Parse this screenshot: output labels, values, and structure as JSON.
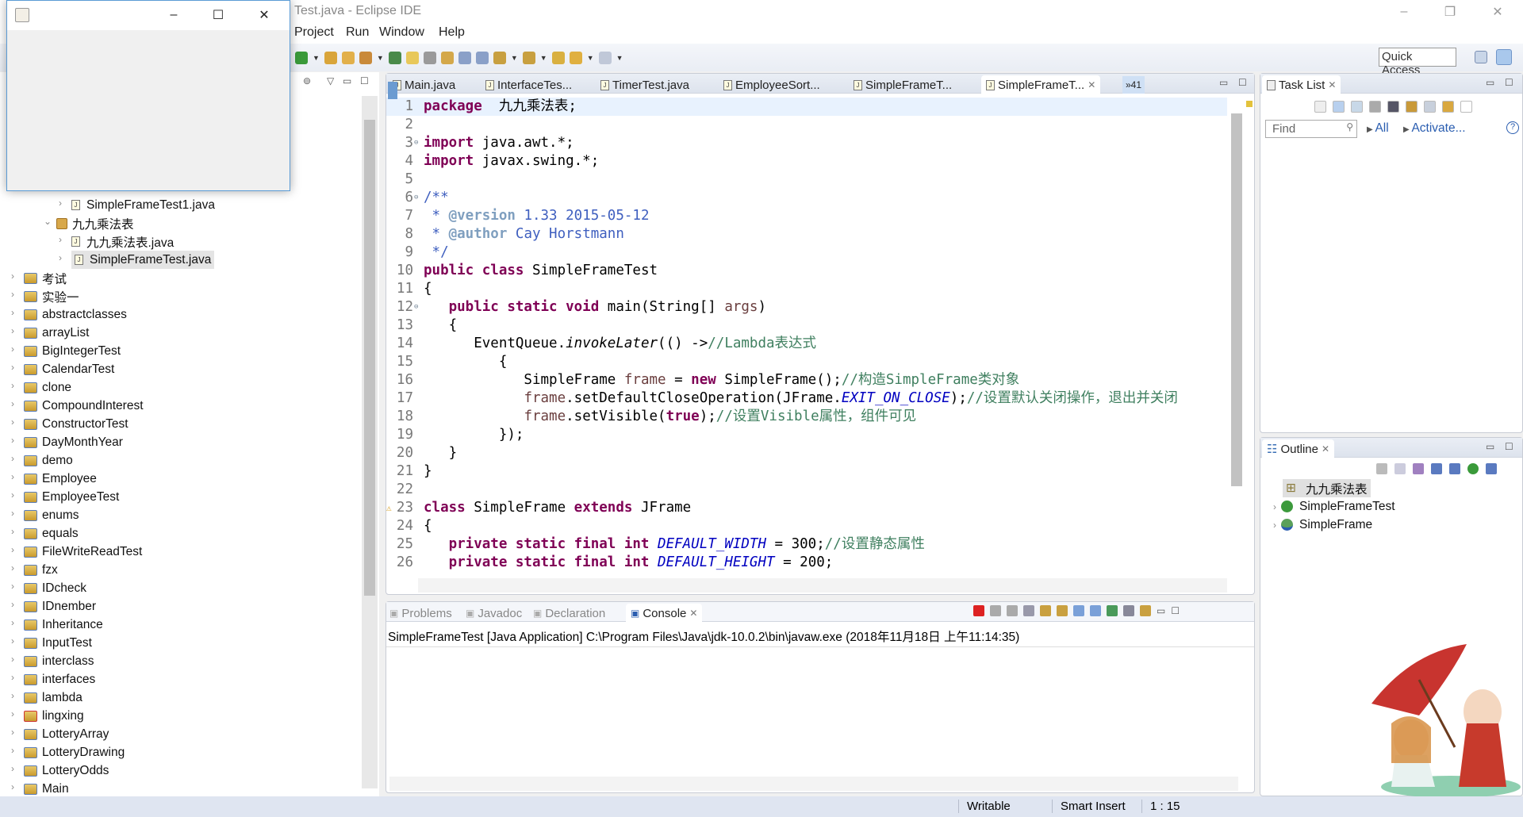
{
  "window": {
    "title": "Test.java - Eclipse IDE",
    "min": "–",
    "restore": "❐",
    "close": "✕"
  },
  "menu": [
    "Project",
    "Run",
    "Window",
    "Help"
  ],
  "toolbar": {
    "icons": [
      "run-icon",
      "dropdown",
      "open-project-icon",
      "open-file-icon",
      "wand-icon",
      "dropdown",
      "help-icon",
      "highlight-icon",
      "tool-icon",
      "annotation-icon",
      "block-icon",
      "pilcrow-icon",
      "next-annotation-icon",
      "dropdown",
      "prev-annotation-icon",
      "dropdown",
      "last-edit-icon",
      "back-icon",
      "dropdown",
      "forward-icon",
      "dropdown"
    ],
    "quick_access": "Quick Access"
  },
  "java_window": {
    "min": "–",
    "max": "☐",
    "close": "✕"
  },
  "explorer": {
    "rows": [
      {
        "label": "SimpleFrameTest1.java",
        "depth": 2,
        "type": "file",
        "expanded": false
      },
      {
        "label": "九九乘法表",
        "depth": 1,
        "type": "package",
        "expanded": true
      },
      {
        "label": "九九乘法表.java",
        "depth": 2,
        "type": "file",
        "expanded": false
      },
      {
        "label": "SimpleFrameTest.java",
        "depth": 2,
        "type": "file",
        "expanded": false,
        "selected": true
      },
      {
        "label": "考试",
        "depth": 0,
        "type": "project"
      },
      {
        "label": "实验一",
        "depth": 0,
        "type": "project"
      },
      {
        "label": "abstractclasses",
        "depth": 0,
        "type": "project"
      },
      {
        "label": "arrayList",
        "depth": 0,
        "type": "project"
      },
      {
        "label": "BigIntegerTest",
        "depth": 0,
        "type": "project"
      },
      {
        "label": "CalendarTest",
        "depth": 0,
        "type": "project"
      },
      {
        "label": "clone",
        "depth": 0,
        "type": "project"
      },
      {
        "label": "CompoundInterest",
        "depth": 0,
        "type": "project"
      },
      {
        "label": "ConstructorTest",
        "depth": 0,
        "type": "project"
      },
      {
        "label": "DayMonthYear",
        "depth": 0,
        "type": "project"
      },
      {
        "label": "demo",
        "depth": 0,
        "type": "project"
      },
      {
        "label": "Employee",
        "depth": 0,
        "type": "project"
      },
      {
        "label": "EmployeeTest",
        "depth": 0,
        "type": "project"
      },
      {
        "label": "enums",
        "depth": 0,
        "type": "project"
      },
      {
        "label": "equals",
        "depth": 0,
        "type": "project"
      },
      {
        "label": "FileWriteReadTest",
        "depth": 0,
        "type": "project"
      },
      {
        "label": "fzx",
        "depth": 0,
        "type": "project"
      },
      {
        "label": "IDcheck",
        "depth": 0,
        "type": "project"
      },
      {
        "label": "IDnember",
        "depth": 0,
        "type": "project"
      },
      {
        "label": "Inheritance",
        "depth": 0,
        "type": "project"
      },
      {
        "label": "InputTest",
        "depth": 0,
        "type": "project"
      },
      {
        "label": "interclass",
        "depth": 0,
        "type": "project"
      },
      {
        "label": "interfaces",
        "depth": 0,
        "type": "project"
      },
      {
        "label": "lambda",
        "depth": 0,
        "type": "project"
      },
      {
        "label": "lingxing",
        "depth": 0,
        "type": "project"
      },
      {
        "label": "LotteryArray",
        "depth": 0,
        "type": "project"
      },
      {
        "label": "LotteryDrawing",
        "depth": 0,
        "type": "project"
      },
      {
        "label": "LotteryOdds",
        "depth": 0,
        "type": "project"
      },
      {
        "label": "Main",
        "depth": 0,
        "type": "project"
      }
    ]
  },
  "editor": {
    "tabs": [
      "Main.java",
      "InterfaceTes...",
      "TimerTest.java",
      "EmployeeSort...",
      "SimpleFrameT...",
      "SimpleFrameT..."
    ],
    "active_tab": 5,
    "overflow": "»41",
    "lines": [
      [
        [
          "kw",
          "package"
        ],
        [
          "",
          "  九九乘法表;"
        ]
      ],
      [],
      [
        [
          "kw",
          "import"
        ],
        [
          "",
          " java.awt.*;"
        ]
      ],
      [
        [
          "kw",
          "import"
        ],
        [
          "",
          " javax.swing.*;"
        ]
      ],
      [],
      [
        [
          "doc",
          "/**"
        ]
      ],
      [
        [
          "doc",
          " * "
        ],
        [
          "tag",
          "@version"
        ],
        [
          "doc",
          " 1.33 2015-05-12"
        ]
      ],
      [
        [
          "doc",
          " * "
        ],
        [
          "tag",
          "@author"
        ],
        [
          "doc",
          " Cay Horstmann"
        ]
      ],
      [
        [
          "doc",
          " */"
        ]
      ],
      [
        [
          "kw",
          "public class"
        ],
        [
          "",
          " SimpleFrameTest"
        ]
      ],
      [
        [
          "",
          "{"
        ]
      ],
      [
        [
          "",
          "   "
        ],
        [
          "kw",
          "public static void"
        ],
        [
          "",
          " main(String[] "
        ],
        [
          "var",
          "args"
        ],
        [
          "",
          ")"
        ]
      ],
      [
        [
          "",
          "   {"
        ]
      ],
      [
        [
          "",
          "      EventQueue."
        ],
        [
          "it",
          "invokeLater"
        ],
        [
          "",
          "(() ->"
        ],
        [
          "cm",
          "//Lambda表达式"
        ]
      ],
      [
        [
          "",
          "         {"
        ]
      ],
      [
        [
          "",
          "            SimpleFrame "
        ],
        [
          "var",
          "frame"
        ],
        [
          "",
          " = "
        ],
        [
          "kw",
          "new"
        ],
        [
          "",
          " SimpleFrame();"
        ],
        [
          "cm",
          "//构造SimpleFrame类对象"
        ]
      ],
      [
        [
          "",
          "            "
        ],
        [
          "var",
          "frame"
        ],
        [
          "",
          ".setDefaultCloseOperation(JFrame."
        ],
        [
          "const",
          "EXIT_ON_CLOSE"
        ],
        [
          "",
          ");"
        ],
        [
          "cm",
          "//设置默认关闭操作，退出并关闭"
        ]
      ],
      [
        [
          "",
          "            "
        ],
        [
          "var",
          "frame"
        ],
        [
          "",
          ".setVisible("
        ],
        [
          "kw",
          "true"
        ],
        [
          "",
          ");"
        ],
        [
          "cm",
          "//设置Visible属性，组件可见"
        ]
      ],
      [
        [
          "",
          "         });"
        ]
      ],
      [
        [
          "",
          "   }"
        ]
      ],
      [
        [
          "",
          "}"
        ]
      ],
      [],
      [
        [
          "kw",
          "class"
        ],
        [
          "",
          " SimpleFrame "
        ],
        [
          "kw",
          "extends"
        ],
        [
          "",
          " JFrame"
        ]
      ],
      [
        [
          "",
          "{"
        ]
      ],
      [
        [
          "",
          "   "
        ],
        [
          "kw",
          "private static final int"
        ],
        [
          "",
          " "
        ],
        [
          "const",
          "DEFAULT_WIDTH"
        ],
        [
          "",
          " = 300;"
        ],
        [
          "cm",
          "//设置静态属性"
        ]
      ],
      [
        [
          "",
          "   "
        ],
        [
          "kw",
          "private static final int"
        ],
        [
          "",
          " "
        ],
        [
          "const",
          "DEFAULT_HEIGHT"
        ],
        [
          "",
          " = 200;"
        ]
      ]
    ]
  },
  "console": {
    "tabs": [
      "Problems",
      "Javadoc",
      "Declaration",
      "Console"
    ],
    "active_tab": 3,
    "text": "SimpleFrameTest [Java Application] C:\\Program Files\\Java\\jdk-10.0.2\\bin\\javaw.exe (2018年11月18日 上午11:14:35)"
  },
  "tasklist": {
    "title": "Task List",
    "find_placeholder": "Find",
    "all": "All",
    "activate": "Activate..."
  },
  "outline": {
    "title": "Outline",
    "items": [
      {
        "label": "九九乘法表",
        "kind": "package-declaration"
      },
      {
        "label": "SimpleFrameTest",
        "kind": "class"
      },
      {
        "label": "SimpleFrame",
        "kind": "class"
      }
    ]
  },
  "status": {
    "writable": "Writable",
    "insert_mode": "Smart Insert",
    "position": "1 : 15"
  },
  "colors": {
    "keyword": "#7f0055",
    "comment": "#3f7f5f",
    "javadoc": "#3f5fbf",
    "constant": "#0000c0",
    "link": "#2a5db0"
  }
}
